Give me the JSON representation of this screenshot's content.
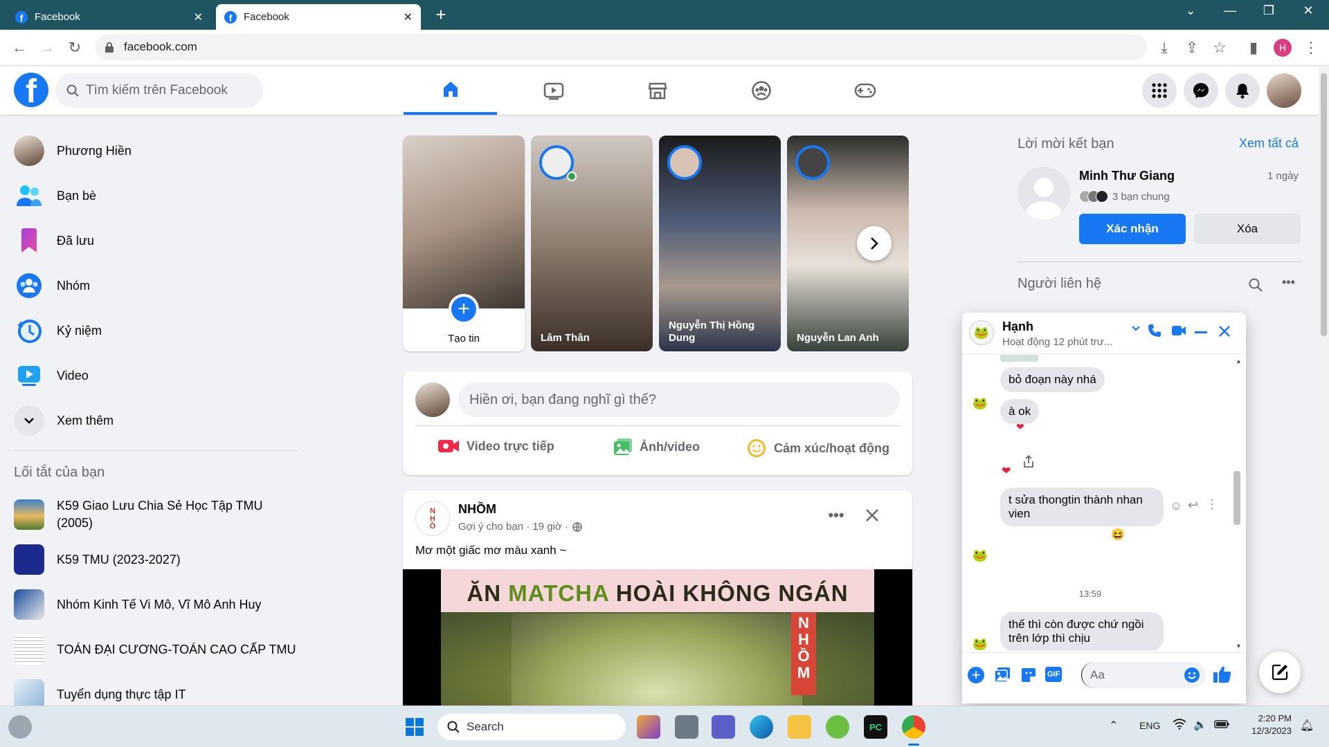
{
  "browser": {
    "tabs": [
      {
        "title": "Facebook",
        "active": false
      },
      {
        "title": "Facebook",
        "active": true
      }
    ],
    "url": "facebook.com",
    "profile_initial": "H"
  },
  "header": {
    "search_placeholder": "Tìm kiếm trên Facebook"
  },
  "sidebar": {
    "items": [
      {
        "label": "Phương Hiền"
      },
      {
        "label": "Bạn bè"
      },
      {
        "label": "Đã lưu"
      },
      {
        "label": "Nhóm"
      },
      {
        "label": "Kỷ niệm"
      },
      {
        "label": "Video"
      },
      {
        "label": "Xem thêm"
      }
    ],
    "shortcuts_title": "Lối tắt của bạn",
    "shortcuts": [
      {
        "label": "K59 Giao Lưu Chia Sẻ Học Tập TMU (2005)"
      },
      {
        "label": "K59 TMU (2023-2027)"
      },
      {
        "label": "Nhóm Kinh Tế Vi Mô, Vĩ Mô Anh Huy"
      },
      {
        "label": "TOÁN ĐẠI CƯƠNG-TOÁN CAO CẤP TMU"
      },
      {
        "label": "Tuyển dụng thực tập IT"
      }
    ]
  },
  "stories": [
    {
      "label": "Tạo tin"
    },
    {
      "label": "Lâm Thân"
    },
    {
      "label": "Nguyễn Thị Hồng Dung"
    },
    {
      "label": "Nguyễn Lan Anh"
    }
  ],
  "composer": {
    "placeholder": "Hiền ơi, bạn đang nghĩ gì thế?",
    "actions": [
      {
        "label": "Video trực tiếp"
      },
      {
        "label": "Ảnh/video"
      },
      {
        "label": "Cảm xúc/hoạt động"
      }
    ]
  },
  "post": {
    "author": "NHỒM",
    "meta": "Gợi ý cho bạn · 19 giờ ·",
    "text": "Mơ một giấc mơ màu xanh ~",
    "image_caption_1": "ĂN",
    "image_caption_2": "MATCHA",
    "image_caption_3": "HOÀI KHÔNG NGÁN"
  },
  "right": {
    "friend_requests_title": "Lời mời kết bạn",
    "see_all": "Xem tất cả",
    "request": {
      "name": "Minh Thư Giang",
      "time": "1 ngày",
      "mutual": "3 bạn chung",
      "confirm": "Xác nhận",
      "delete": "Xóa"
    },
    "contacts_title": "Người liên hệ"
  },
  "chat": {
    "name": "Hạnh",
    "status": "Hoạt động 12 phút trư...",
    "messages": [
      {
        "text": "bỏ đoạn này nhá"
      },
      {
        "text": "à ok"
      },
      {
        "text": "t sửa  thongtin thành nhan vien"
      },
      {
        "text": "thế thì còn được chứ ngồi trên lớp thì chịu"
      }
    ],
    "timestamp": "13:59",
    "input_placeholder": "Aa"
  },
  "taskbar": {
    "search_label": "Search",
    "lang": "ENG",
    "time": "2:20 PM",
    "date": "12/3/2023"
  },
  "colors": {
    "brand": "#1877f2",
    "tabbar": "#1f5560"
  }
}
